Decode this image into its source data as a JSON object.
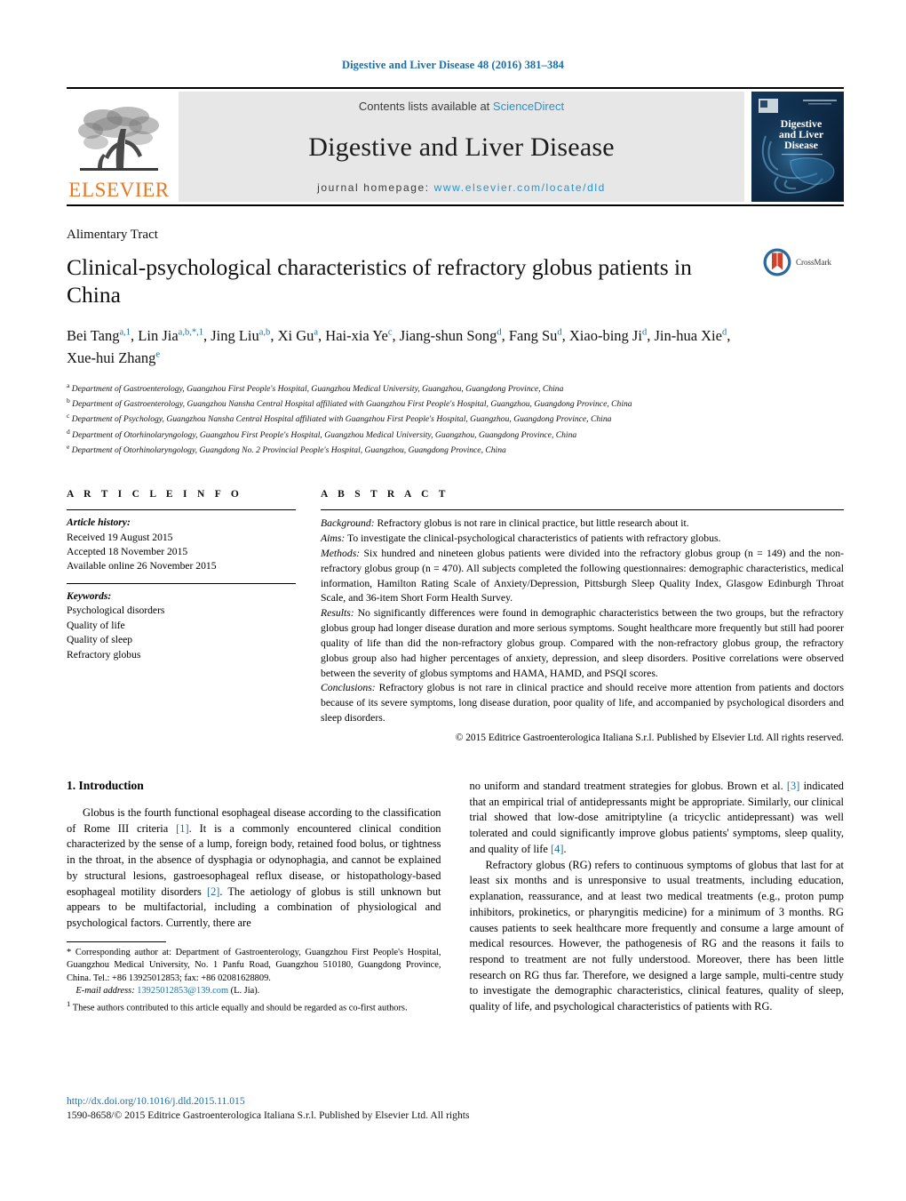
{
  "running_head": "Digestive and Liver Disease 48 (2016) 381–384",
  "masthead": {
    "publisher_name": "ELSEVIER",
    "contents_prefix": "Contents lists available at ",
    "contents_link": "ScienceDirect",
    "journal_title": "Digestive and Liver Disease",
    "homepage_prefix": "journal homepage: ",
    "homepage_url": "www.elsevier.com/locate/dld",
    "cover_title_line1": "Digestive",
    "cover_title_line2": "and Liver",
    "cover_title_line3": "Disease"
  },
  "article": {
    "section_label": "Alimentary Tract",
    "title": "Clinical-psychological characteristics of refractory globus patients in China",
    "crossmark_label": "CrossMark",
    "authors_html": "Bei Tang<sup>a,1</sup>, Lin Jia<sup>a,b,<span class=\"plain\">*</span>,1</sup>, Jing Liu<sup>a,b</sup>, Xi Gu<sup>a</sup>, Hai-xia Ye<sup>c</sup>, Jiang-shun Song<sup>d</sup>, Fang Su<sup>d</sup>, Xiao-bing Ji<sup>d</sup>, Jin-hua Xie<sup>d</sup>, Xue-hui Zhang<sup>e</sup>",
    "affiliations": [
      {
        "marker": "a",
        "text": "Department of Gastroenterology, Guangzhou First People's Hospital, Guangzhou Medical University, Guangzhou, Guangdong Province, China"
      },
      {
        "marker": "b",
        "text": "Department of Gastroenterology, Guangzhou Nansha Central Hospital affiliated with Guangzhou First People's Hospital, Guangzhou, Guangdong Province, China"
      },
      {
        "marker": "c",
        "text": "Department of Psychology, Guangzhou Nansha Central Hospital affiliated with Guangzhou First People's Hospital, Guangzhou, Guangdong Province, China"
      },
      {
        "marker": "d",
        "text": "Department of Otorhinolaryngology, Guangzhou First People's Hospital, Guangzhou Medical University, Guangzhou, Guangdong Province, China"
      },
      {
        "marker": "e",
        "text": "Department of Otorhinolaryngology, Guangdong No. 2 Provincial People's Hospital, Guangzhou, Guangdong Province, China"
      }
    ]
  },
  "article_info": {
    "heading": "A R T I C L E   I N F O",
    "history_label": "Article history:",
    "history": [
      "Received 19 August 2015",
      "Accepted 18 November 2015",
      "Available online 26 November 2015"
    ],
    "keywords_label": "Keywords:",
    "keywords": [
      "Psychological disorders",
      "Quality of life",
      "Quality of sleep",
      "Refractory globus"
    ]
  },
  "abstract": {
    "heading": "A B S T R A C T",
    "sections": [
      {
        "label": "Background:",
        "text": " Refractory globus is not rare in clinical practice, but little research about it."
      },
      {
        "label": "Aims:",
        "text": " To investigate the clinical-psychological characteristics of patients with refractory globus."
      },
      {
        "label": "Methods:",
        "text": " Six hundred and nineteen globus patients were divided into the refractory globus group (n = 149) and the non-refractory globus group (n = 470). All subjects completed the following questionnaires: demographic characteristics, medical information, Hamilton Rating Scale of Anxiety/Depression, Pittsburgh Sleep Quality Index, Glasgow Edinburgh Throat Scale, and 36-item Short Form Health Survey."
      },
      {
        "label": "Results:",
        "text": " No significantly differences were found in demographic characteristics between the two groups, but the refractory globus group had longer disease duration and more serious symptoms. Sought healthcare more frequently but still had poorer quality of life than did the non-refractory globus group. Compared with the non-refractory globus group, the refractory globus group also had higher percentages of anxiety, depression, and sleep disorders. Positive correlations were observed between the severity of globus symptoms and HAMA, HAMD, and PSQI scores."
      },
      {
        "label": "Conclusions:",
        "text": " Refractory globus is not rare in clinical practice and should receive more attention from patients and doctors because of its severe symptoms, long disease duration, poor quality of life, and accompanied by psychological disorders and sleep disorders."
      }
    ],
    "copyright": "© 2015 Editrice Gastroenterologica Italiana S.r.l. Published by Elsevier Ltd. All rights reserved."
  },
  "body": {
    "intro_heading": "1. Introduction",
    "left_paragraph_1_html": "Globus is the fourth functional esophageal disease according to the classification of Rome III criteria <span class=\"ref\">[1]</span>. It is a commonly encountered clinical condition characterized by the sense of a lump, foreign body, retained food bolus, or tightness in the throat, in the absence of dysphagia or odynophagia, and cannot be explained by structural lesions, gastroesophageal reflux disease, or histopathology-based esophageal motility disorders <span class=\"ref\">[2]</span>. The aetiology of globus is still unknown but appears to be multifactorial, including a combination of physiological and psychological factors. Currently, there are",
    "right_paragraph_1_html": "no uniform and standard treatment strategies for globus. Brown et al. <span class=\"ref\">[3]</span> indicated that an empirical trial of antidepressants might be appropriate. Similarly, our clinical trial showed that low-dose amitriptyline (a tricyclic antidepressant) was well tolerated and could significantly improve globus patients' symptoms, sleep quality, and quality of life <span class=\"ref\">[4]</span>.",
    "right_paragraph_2_html": "Refractory globus (RG) refers to continuous symptoms of globus that last for at least six months and is unresponsive to usual treatments, including education, explanation, reassurance, and at least two medical treatments (e.g., proton pump inhibitors, prokinetics, or pharyngitis medicine) for a minimum of 3 months. RG causes patients to seek healthcare more frequently and consume a large amount of medical resources. However, the pathogenesis of RG and the reasons it fails to respond to treatment are not fully understood. Moreover, there has been little research on RG thus far. Therefore, we designed a large sample, multi-centre study to investigate the demographic characteristics, clinical features, quality of sleep, quality of life, and psychological characteristics of patients with RG."
  },
  "footnotes": {
    "corresponding_html": "<span class=\"lead-in\"></span>* Corresponding author at: Department of Gastroenterology, Guangzhou First People's Hospital, Guangzhou Medical University, No. 1 Panfu Road, Guangzhou 510180, Guangdong Province, China. Tel.: +86 13925012853; fax: +86 02081628809.",
    "email_label": "E-mail address:",
    "email_value": "13925012853@139.com",
    "email_suffix": " (L. Jia).",
    "equal_contribution_html": "<sup>1</sup> These authors contributed to this article equally and should be regarded as co-first authors."
  },
  "page_footer": {
    "doi": "http://dx.doi.org/10.1016/j.dld.2015.11.015",
    "issn_line": "1590-8658/© 2015 Editrice Gastroenterologica Italiana S.r.l. Published by Elsevier Ltd. All rights"
  },
  "colors": {
    "link_blue": "#1a6ea8",
    "sciencedirect_blue": "#2a92c7",
    "elsevier_orange": "#E87722",
    "band_grey": "#e7e7e7",
    "cover_navy": "#0e2a45"
  }
}
